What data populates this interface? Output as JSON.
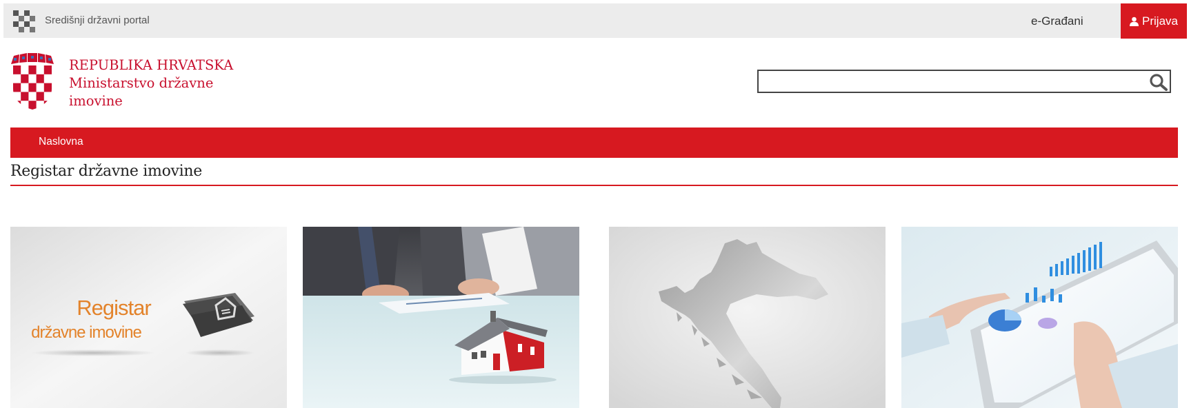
{
  "topbar": {
    "portal_name": "Središnji državni portal",
    "egradani_label": "e-Građani",
    "login_label": "Prijava",
    "login_color": "#d71920"
  },
  "header": {
    "ministry_line1": "REPUBLIKA HRVATSKA",
    "ministry_line2": "Ministarstvo državne",
    "ministry_line3": "imovine",
    "search_value": "",
    "brand_color": "#d71920"
  },
  "nav": {
    "items": [
      {
        "label": "Naslovna"
      }
    ]
  },
  "page": {
    "title": "Registar državne imovine"
  },
  "tiles": [
    {
      "line1": "Registar",
      "line2": "državne imovine",
      "icon": "house-folder-icon"
    },
    {
      "image": "house-contract-photo"
    },
    {
      "image": "croatia-map-photo"
    },
    {
      "image": "tablet-charts-photo"
    }
  ]
}
